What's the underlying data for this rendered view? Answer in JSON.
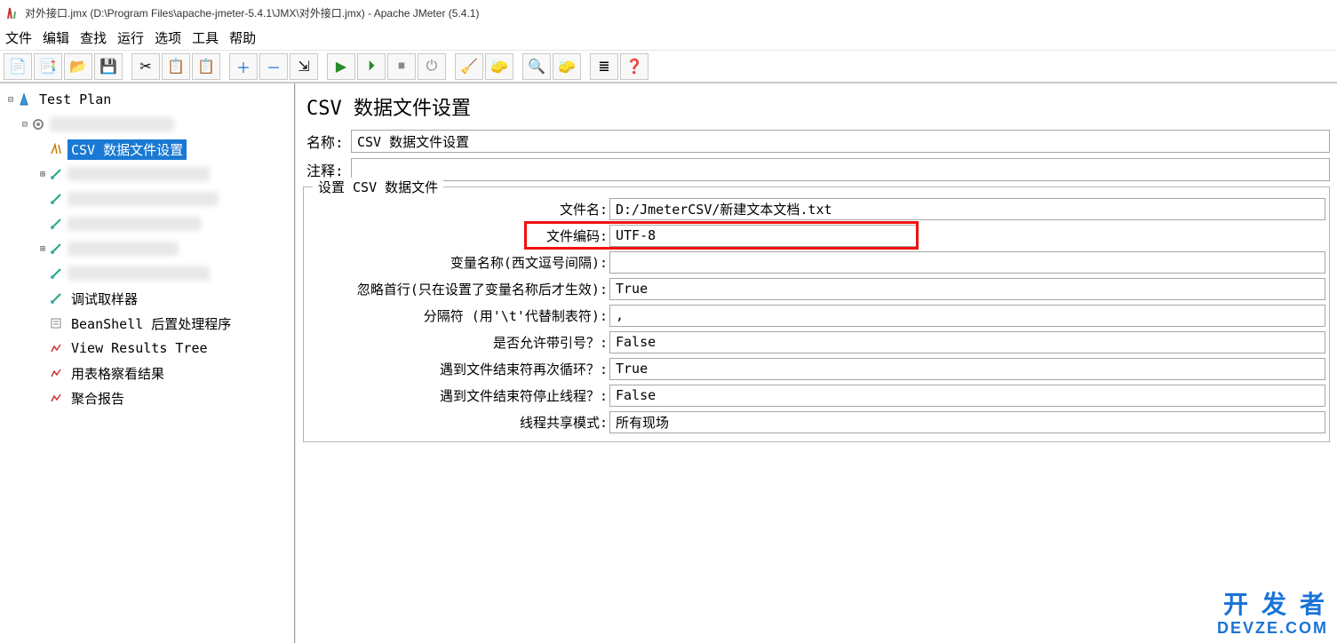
{
  "window": {
    "title": "对外接口.jmx (D:\\Program Files\\apache-jmeter-5.4.1\\JMX\\对外接口.jmx) - Apache JMeter (5.4.1)"
  },
  "menu": {
    "file": "文件",
    "edit": "编辑",
    "search": "查找",
    "run": "运行",
    "options": "选项",
    "tools": "工具",
    "help": "帮助"
  },
  "toolbar_icons": {
    "new": "📄",
    "templates": "📑",
    "open": "📂",
    "save": "💾",
    "cut": "✂",
    "copy": "📋",
    "paste": "📋",
    "add": "＋",
    "remove": "－",
    "expand": "⇲",
    "start": "▶",
    "start_no": "⏵",
    "stop": "⏹",
    "shutdown": "⏻",
    "clear": "🧹",
    "clear_all": "🧽",
    "search2": "🔍",
    "reset_search": "🧽",
    "fn": "≣",
    "help": "❓"
  },
  "tree": {
    "root": "Test Plan",
    "thread_group": "",
    "csv_config": "CSV 数据文件设置",
    "n3": "",
    "n4": "",
    "n5": "",
    "n6": "",
    "n7": "",
    "debug_sampler": "调试取样器",
    "beanshell": "BeanShell 后置处理程序",
    "view_results": "View Results Tree",
    "table_results": "用表格察看结果",
    "aggregate": "聚合报告"
  },
  "panel": {
    "title": "CSV 数据文件设置",
    "name_label": "名称:",
    "name_value": "CSV 数据文件设置",
    "comment_label": "注释:",
    "comment_value": "",
    "fieldset_legend": "设置 CSV 数据文件",
    "rows": {
      "filename_l": "文件名:",
      "filename_v": "D:/JmeterCSV/新建文本文档.txt",
      "encoding_l": "文件编码:",
      "encoding_v": "UTF-8",
      "varnames_l": "变量名称(西文逗号间隔):",
      "varnames_v": "",
      "ignore_l": "忽略首行(只在设置了变量名称后才生效):",
      "ignore_v": "True",
      "delim_l": "分隔符 (用'\\t'代替制表符):",
      "delim_v": ",",
      "quoted_l": "是否允许带引号？:",
      "quoted_v": "False",
      "recycle_l": "遇到文件结束符再次循环？:",
      "recycle_v": "True",
      "stop_l": "遇到文件结束符停止线程？:",
      "stop_v": "False",
      "share_l": "线程共享模式:",
      "share_v": "所有现场"
    }
  },
  "watermark": {
    "cn": "开 发 者",
    "en": "DevZe.CoM"
  }
}
